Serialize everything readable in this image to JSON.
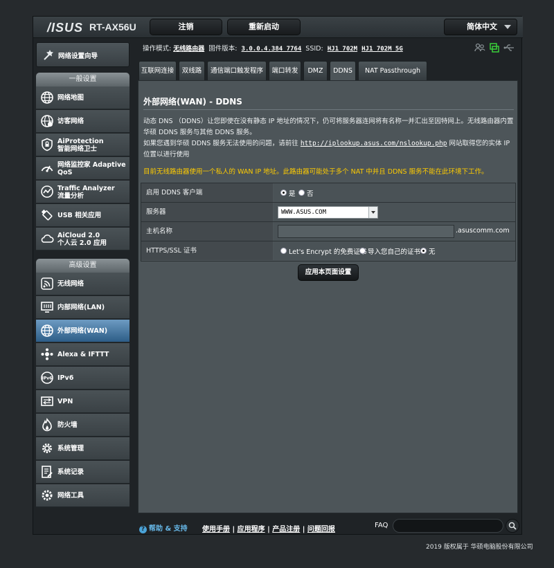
{
  "header": {
    "logo": "/ISUS",
    "model": "RT-AX56U",
    "logout_label": "注销",
    "reboot_label": "重新启动",
    "language": "简体中文"
  },
  "sidebar": {
    "quick_label": "网络设置向导",
    "general_title": "一般设置",
    "general_items": [
      {
        "label": "网络地图",
        "icon": "globe-icon"
      },
      {
        "label": "访客网络",
        "icon": "guest-network-icon"
      },
      {
        "label": "AiProtection",
        "label2": "智能网络卫士",
        "icon": "shield-icon"
      },
      {
        "label": "网络监控家 Adaptive",
        "label2": "QoS",
        "icon": "speedometer-icon"
      },
      {
        "label": "Traffic Analyzer",
        "label2": "流量分析",
        "icon": "traffic-analyzer-icon"
      },
      {
        "label": "USB 相关应用",
        "icon": "usb-icon"
      },
      {
        "label": "AiCloud 2.0",
        "label2": "个人云 2.0 应用",
        "icon": "cloud-icon"
      }
    ],
    "advanced_title": "高级设置",
    "advanced_items": [
      {
        "label": "无线网络",
        "icon": "wireless-icon"
      },
      {
        "label": "内部网络(LAN)",
        "icon": "lan-icon"
      },
      {
        "label": "外部网络(WAN)",
        "icon": "wan-globe-icon"
      },
      {
        "label": "Alexa & IFTTT",
        "icon": "alexa-icon"
      },
      {
        "label": "IPv6",
        "icon": "ipv6-icon"
      },
      {
        "label": "VPN",
        "icon": "vpn-icon"
      },
      {
        "label": "防火墙",
        "icon": "firewall-icon"
      },
      {
        "label": "系统管理",
        "icon": "system-gear-icon"
      },
      {
        "label": "系统记录",
        "icon": "system-log-icon"
      },
      {
        "label": "网络工具",
        "icon": "network-tools-icon"
      }
    ]
  },
  "status": {
    "mode_label": "操作模式:",
    "mode_value": "无线路由器",
    "fw_label": "固件版本:",
    "fw_value": "3.0.0.4.384_7764",
    "ssid_label": "SSID:",
    "ssid_1": "HJ1_702M",
    "ssid_2": "HJ1_702M_5G"
  },
  "tabs": [
    "互联网连接",
    "双线路",
    "通信端口触发程序",
    "端口转发",
    "DMZ",
    "DDNS",
    "NAT Passthrough"
  ],
  "panel": {
    "title": "外部网络(WAN) - DDNS",
    "desc1": "动态 DNS （DDNS）让您即使在没有静态 IP 地址的情况下，仍可将服务器连网将有名称一并汇出至因特网上。无线路由器内置华硕 DDNS 服务与其他 DDNS 服务。",
    "desc2_a": "如果您遇到华硕 DDNS 服务无法使用的问题，请前往",
    "desc2_link": "http://iplookup.asus.com/nslookup.php",
    "desc2_b": "网站取得您的实体 IP 位置以进行使用",
    "warning": "目前无线路由器使用一个私人的 WAN IP 地址。此路由器可能处于多个 NAT 中并且 DDNS 服务不能在此环境下工作。",
    "rows": {
      "enable_label": "启用 DDNS 客户端",
      "enable_yes": "是",
      "enable_no": "否",
      "server_label": "服务器",
      "server_value": "WWW.ASUS.COM",
      "host_label": "主机名称",
      "host_value": "",
      "host_suffix": ".asuscomm.com",
      "ssl_label": "HTTPS/SSL 证书",
      "ssl_opt1": "Let's Encrypt 的免费证书",
      "ssl_opt2": "导入您自己的证书",
      "ssl_opt3": "无"
    },
    "apply_label": "应用本页面设置"
  },
  "footer": {
    "help_label": "帮助 & 支持",
    "links": [
      "使用手册",
      "应用程序",
      "产品注册",
      "问题回报"
    ],
    "faq_label": "FAQ",
    "copyright": "2019 版权属于 华硕电脑股份有限公司"
  }
}
